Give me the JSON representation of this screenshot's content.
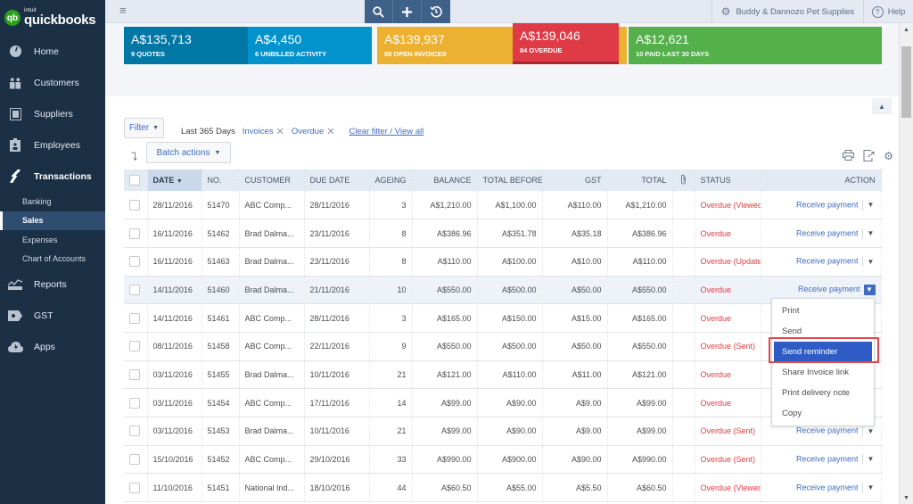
{
  "brand": {
    "intuit": "intuit",
    "name": "quickbooks",
    "badge": "qb",
    "accent": "#2ca01c"
  },
  "sidebar": {
    "items": [
      {
        "label": "Home",
        "icon": "dashboard-icon"
      },
      {
        "label": "Customers",
        "icon": "customers-icon"
      },
      {
        "label": "Suppliers",
        "icon": "suppliers-icon"
      },
      {
        "label": "Employees",
        "icon": "employees-icon"
      },
      {
        "label": "Transactions",
        "icon": "transactions-icon"
      }
    ],
    "sub_items": [
      {
        "label": "Banking"
      },
      {
        "label": "Sales",
        "active": true
      },
      {
        "label": "Expenses"
      },
      {
        "label": "Chart of Accounts"
      }
    ],
    "lower_items": [
      {
        "label": "Reports",
        "icon": "reports-icon"
      },
      {
        "label": "GST",
        "icon": "gst-icon"
      },
      {
        "label": "Apps",
        "icon": "apps-icon"
      }
    ]
  },
  "topbar": {
    "company": "Buddy & Dannozo Pet Supplies",
    "help": "Help"
  },
  "moneybar": {
    "quotes": {
      "amount": "A$135,713",
      "label": "9 QUOTES",
      "color": "#0077a5"
    },
    "unbilled": {
      "amount": "A$4,450",
      "label": "6 UNBILLED ACTIVITY",
      "color": "#0393cc"
    },
    "open": {
      "amount": "A$139,937",
      "label": "88 OPEN INVOICES",
      "color": "#ecb130"
    },
    "overdue": {
      "amount": "A$139,046",
      "label": "84 OVERDUE",
      "color": "#df3b46"
    },
    "paid": {
      "amount": "A$12,621",
      "label": "10 PAID LAST 30 DAYS",
      "color": "#53b04a"
    }
  },
  "filters": {
    "filter_label": "Filter",
    "period": "Last 365 Days",
    "chips": [
      "Invoices",
      "Overdue"
    ],
    "clear": "Clear filter / View all",
    "batch_actions": "Batch actions"
  },
  "table": {
    "columns": [
      "DATE",
      "NO.",
      "CUSTOMER",
      "DUE DATE",
      "AGEING",
      "BALANCE",
      "TOTAL BEFORE",
      "GST",
      "TOTAL",
      "",
      "STATUS",
      "ACTION"
    ],
    "action_label": "Receive payment",
    "rows": [
      {
        "date": "28/11/2016",
        "no": "51470",
        "customer": "ABC Comp...",
        "due": "28/11/2016",
        "ageing": "3",
        "balance": "A$1,210.00",
        "before": "A$1,100.00",
        "gst": "A$110.00",
        "total": "A$1,210.00",
        "status": "Overdue (Viewed)"
      },
      {
        "date": "16/11/2016",
        "no": "51462",
        "customer": "Brad Dalma...",
        "due": "23/11/2016",
        "ageing": "8",
        "balance": "A$386.96",
        "before": "A$351.78",
        "gst": "A$35.18",
        "total": "A$386.96",
        "status": "Overdue"
      },
      {
        "date": "16/11/2016",
        "no": "51463",
        "customer": "Brad Dalma...",
        "due": "23/11/2016",
        "ageing": "8",
        "balance": "A$110.00",
        "before": "A$100.00",
        "gst": "A$10.00",
        "total": "A$110.00",
        "status": "Overdue (Updated)"
      },
      {
        "date": "14/11/2016",
        "no": "51460",
        "customer": "Brad Dalma...",
        "due": "21/11/2016",
        "ageing": "10",
        "balance": "A$550.00",
        "before": "A$500.00",
        "gst": "A$50.00",
        "total": "A$550.00",
        "status": "Overdue"
      },
      {
        "date": "14/11/2016",
        "no": "51461",
        "customer": "ABC Comp...",
        "due": "28/11/2016",
        "ageing": "3",
        "balance": "A$165.00",
        "before": "A$150.00",
        "gst": "A$15.00",
        "total": "A$165.00",
        "status": "Overdue"
      },
      {
        "date": "08/11/2016",
        "no": "51458",
        "customer": "ABC Comp...",
        "due": "22/11/2016",
        "ageing": "9",
        "balance": "A$550.00",
        "before": "A$500.00",
        "gst": "A$50.00",
        "total": "A$550.00",
        "status": "Overdue (Sent)"
      },
      {
        "date": "03/11/2016",
        "no": "51455",
        "customer": "Brad Dalma...",
        "due": "10/11/2016",
        "ageing": "21",
        "balance": "A$121.00",
        "before": "A$110.00",
        "gst": "A$11.00",
        "total": "A$121.00",
        "status": "Overdue"
      },
      {
        "date": "03/11/2016",
        "no": "51454",
        "customer": "ABC Comp...",
        "due": "17/11/2016",
        "ageing": "14",
        "balance": "A$99.00",
        "before": "A$90.00",
        "gst": "A$9.00",
        "total": "A$99.00",
        "status": "Overdue"
      },
      {
        "date": "03/11/2016",
        "no": "51453",
        "customer": "Brad Dalma...",
        "due": "10/11/2016",
        "ageing": "21",
        "balance": "A$99.00",
        "before": "A$90.00",
        "gst": "A$9.00",
        "total": "A$99.00",
        "status": "Overdue (Sent)"
      },
      {
        "date": "15/10/2016",
        "no": "51452",
        "customer": "ABC Comp...",
        "due": "29/10/2016",
        "ageing": "33",
        "balance": "A$990.00",
        "before": "A$900.00",
        "gst": "A$90.00",
        "total": "A$990.00",
        "status": "Overdue (Sent)"
      },
      {
        "date": "11/10/2016",
        "no": "51451",
        "customer": "National Ind...",
        "due": "18/10/2016",
        "ageing": "44",
        "balance": "A$60.50",
        "before": "A$55.00",
        "gst": "A$5.50",
        "total": "A$60.50",
        "status": "Overdue (Viewed)"
      }
    ]
  },
  "action_menu": {
    "items": [
      "Print",
      "Send",
      "Send reminder",
      "Share Invoice link",
      "Print delivery note",
      "Copy"
    ],
    "selected": "Send reminder"
  }
}
